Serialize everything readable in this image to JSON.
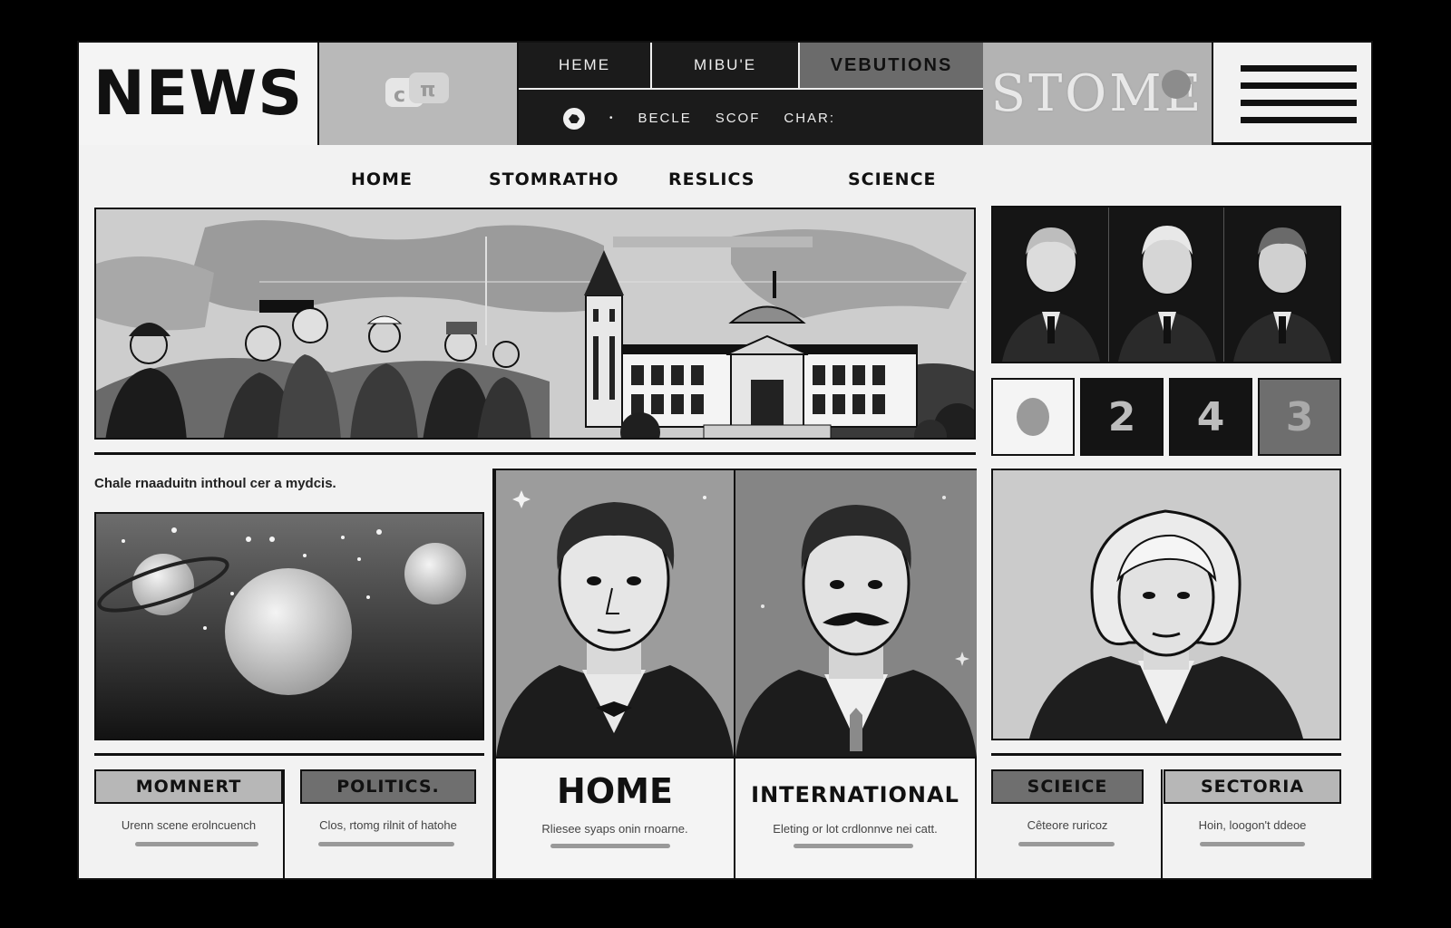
{
  "header": {
    "logo": "NEWS",
    "top_nav": [
      "HEME",
      "MIBU'E",
      "VEBUTIONS"
    ],
    "sub_nav": [
      "BECLE",
      "SCOF",
      "CHAR:"
    ],
    "promo_text": "STOME"
  },
  "main_nav": [
    "HOME",
    "STOMRATHO",
    "RESLICS",
    "SCIENCE"
  ],
  "pager": [
    "2",
    "4",
    "3"
  ],
  "caption": "Chale rnaaduitn inthoul cer a mydcis.",
  "cards": [
    {
      "tag": "MOMNERT",
      "desc": "Urenn scene erolncuench"
    },
    {
      "tag": "POLITICS.",
      "desc": "Clos, rtomg rilnit of hatohe"
    },
    {
      "tag": "HOME",
      "desc": "Rliesee syaps onin rnoarne."
    },
    {
      "tag": "INTERNATIONAL",
      "desc": "Eleting or lot crdlonnve nei catt."
    },
    {
      "tag": "SCIEICE",
      "desc": "Cêteore ruricoz"
    },
    {
      "tag": "SECTORIA",
      "desc": "Hoin, loogon't ddeoe"
    }
  ],
  "colors": {
    "frame_bg": "#f2f2f2",
    "dark": "#1b1b1b",
    "mid_gray": "#6b6b6b",
    "light_gray": "#b9b9b9"
  }
}
